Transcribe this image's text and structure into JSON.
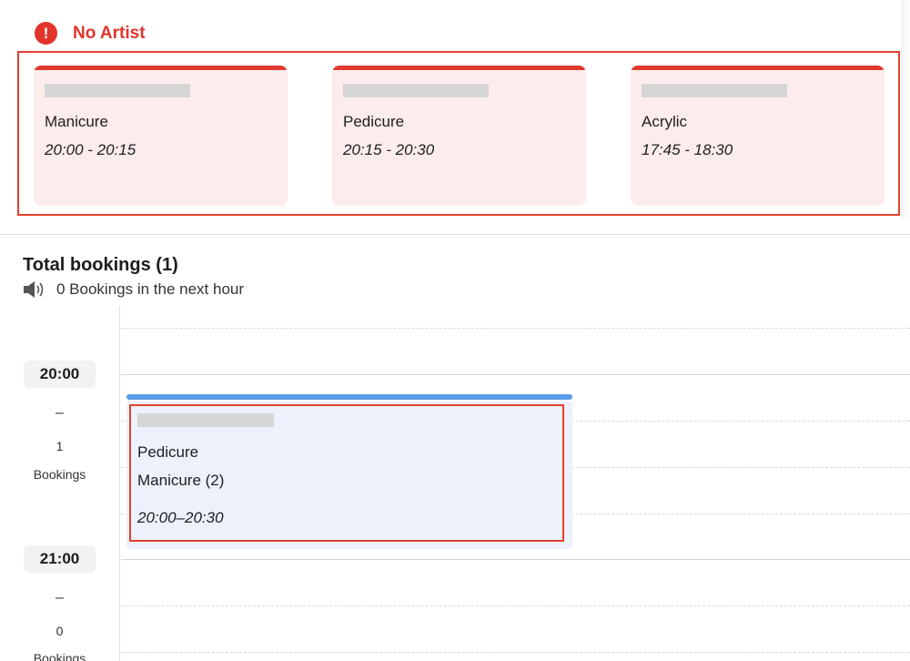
{
  "no_artist": {
    "title": "No Artist",
    "cards": [
      {
        "service": "Manicure",
        "time": "20:00 - 20:15"
      },
      {
        "service": "Pedicure",
        "time": "20:15 - 20:30"
      },
      {
        "service": "Acrylic",
        "time": "17:45 - 18:30"
      }
    ]
  },
  "bookings": {
    "title": "Total bookings (1)",
    "next_hour": "0 Bookings in the next hour",
    "slots": [
      {
        "time": "20:00",
        "dash": "–",
        "count": "1",
        "label": "Bookings"
      },
      {
        "time": "21:00",
        "dash": "–",
        "count": "0",
        "label": "Bookings"
      }
    ],
    "booking": {
      "services": [
        "Pedicure",
        "Manicure (2)"
      ],
      "time": "20:00–20:30"
    }
  },
  "colors": {
    "alert_red": "#e1342b",
    "card_pink": "#fcecec",
    "booking_blue": "#5b9be8",
    "booking_bg": "#edf1fc"
  },
  "icons": [
    "alert-icon",
    "speaker-icon"
  ]
}
